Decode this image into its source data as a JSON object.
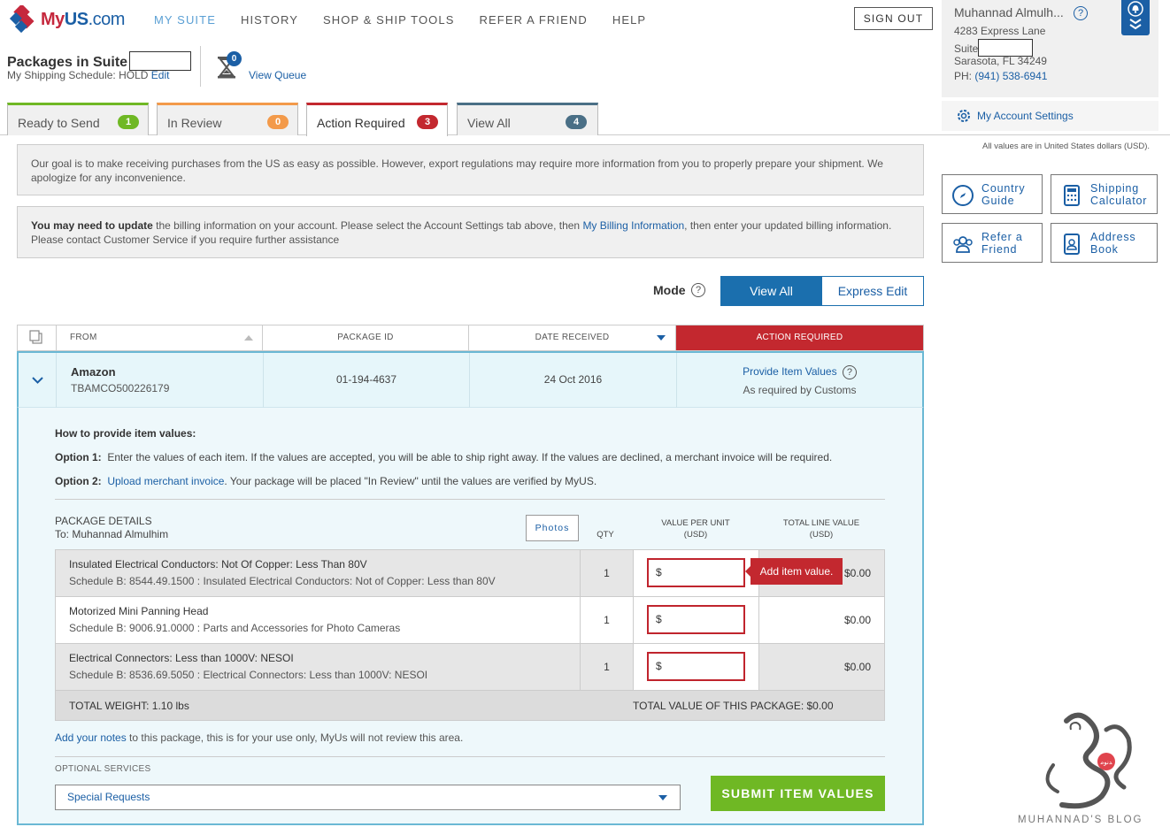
{
  "brand": {
    "name_my": "My",
    "name_us": "US",
    "name_com": ".com"
  },
  "nav": [
    {
      "label": "MY SUITE",
      "active": true
    },
    {
      "label": "HISTORY"
    },
    {
      "label": "SHOP & SHIP TOOLS"
    },
    {
      "label": "REFER A FRIEND"
    },
    {
      "label": "HELP"
    }
  ],
  "sign_out": "SIGN OUT",
  "suite": {
    "title": "Packages in Suite",
    "schedule_label": "My Shipping Schedule: HOLD",
    "edit": "Edit",
    "queue_count": "0",
    "view_queue": "View Queue"
  },
  "account": {
    "name": "Muhannad Almulh...",
    "help": "?",
    "address1": "4283 Express Lane",
    "suite_label": "Suite",
    "city": "Sarasota, FL 34249",
    "phone_label": "PH:",
    "phone": "(941) 538-6941",
    "settings": "My Account Settings",
    "usd_note": "All values are in United States dollars (USD)."
  },
  "tools": [
    {
      "label": "Country\nGuide",
      "icon": "compass-icon"
    },
    {
      "label": "Shipping\nCalculator",
      "icon": "calculator-icon"
    },
    {
      "label": "Refer a\nFriend",
      "icon": "people-icon"
    },
    {
      "label": "Address\nBook",
      "icon": "address-book-icon"
    }
  ],
  "tabs": [
    {
      "label": "Ready to Send",
      "count": "1",
      "color": "#6fb824"
    },
    {
      "label": "In Review",
      "count": "0",
      "color": "#f39a4a"
    },
    {
      "label": "Action Required",
      "count": "3",
      "color": "#c3282f"
    },
    {
      "label": "View All",
      "count": "4",
      "color": "#4a6f86"
    }
  ],
  "notices": {
    "goal": "Our goal is to make receiving purchases from the US as easy as possible. However, export regulations may require more information from you to properly prepare your shipment. We apologize for any inconvenience.",
    "update_bold": "You may need to update",
    "update_text1": " the billing information on your account. Please select the Account Settings tab above, then ",
    "update_link": "My Billing Information",
    "update_text2": ", then enter your updated billing information. Please contact Customer Service if you require further assistance"
  },
  "mode": {
    "label": "Mode",
    "help": "?",
    "view_all": "View All",
    "express_edit": "Express Edit"
  },
  "table": {
    "headers": {
      "from": "FROM",
      "package_id": "PACKAGE ID",
      "date_received": "DATE RECEIVED",
      "action_required": "ACTION REQUIRED"
    },
    "package": {
      "merchant": "Amazon",
      "tracking": "TBAMCO500226179",
      "package_id": "01-194-4637",
      "date": "24 Oct 2016",
      "action_link": "Provide Item Values",
      "action_help": "?",
      "action_sub": "As required by Customs"
    }
  },
  "howto": {
    "title": "How to provide item values:",
    "opt1_label": "Option 1:",
    "opt1_text": "Enter the values of each item. If the values are accepted, you will be able to ship right away. If the values are declined, a merchant invoice will be required.",
    "opt2_label": "Option 2:",
    "opt2_link": "Upload merchant invoice",
    "opt2_text": ". Your package will be placed \"In Review\" until the values are verified by MyUS."
  },
  "details": {
    "title": "PACKAGE DETAILS",
    "to": "To: Muhannad Almulhim",
    "photos": "Photos",
    "col_qty": "QTY",
    "col_value": "VALUE PER UNIT",
    "col_value_unit": "(USD)",
    "col_total": "TOTAL LINE VALUE",
    "col_total_unit": "(USD)",
    "items": [
      {
        "name": "Insulated Electrical Conductors: Not Of Copper: Less Than 80V",
        "schedule": "Schedule B: 8544.49.1500 : Insulated Electrical Conductors: Not of Copper: Less than 80V",
        "qty": "1",
        "value_prefix": "$",
        "total": "$0.00"
      },
      {
        "name": "Motorized Mini Panning Head",
        "schedule": "Schedule B: 9006.91.0000 : Parts and Accessories for Photo Cameras",
        "qty": "1",
        "value_prefix": "$",
        "total": "$0.00"
      },
      {
        "name": "Electrical Connectors: Less than 1000V: NESOI",
        "schedule": "Schedule B: 8536.69.5050 : Electrical Connectors: Less than 1000V: NESOI",
        "qty": "1",
        "value_prefix": "$",
        "total": "$0.00"
      }
    ],
    "total_weight": "TOTAL WEIGHT: 1.10 lbs",
    "total_value": "TOTAL VALUE OF THIS PACKAGE: $0.00",
    "tooltip": "Add item value."
  },
  "notes": {
    "link": "Add your notes",
    "text": " to this package, this is for your use only, MyUs will not review this area."
  },
  "optional": {
    "label": "OPTIONAL SERVICES",
    "select_value": "Special Requests"
  },
  "submit": "SUBMIT ITEM VALUES",
  "watermark": {
    "text": "MUHANNAD'S BLOG"
  }
}
